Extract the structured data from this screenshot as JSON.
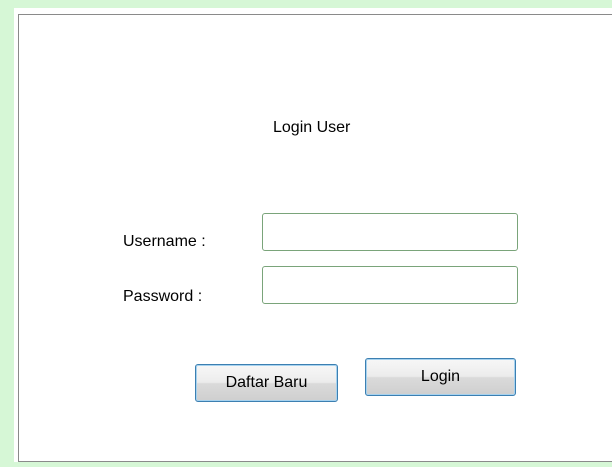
{
  "form": {
    "title": "Login User",
    "username_label": "Username :",
    "username_value": "",
    "password_label": "Password  :",
    "password_value": "",
    "register_button_label": "Daftar Baru",
    "login_button_label": "Login"
  },
  "colors": {
    "frame_background": "#d6f7d6",
    "panel_border": "#8a8a8a",
    "input_border": "#7aa47a",
    "button_border": "#3c7fb1"
  }
}
